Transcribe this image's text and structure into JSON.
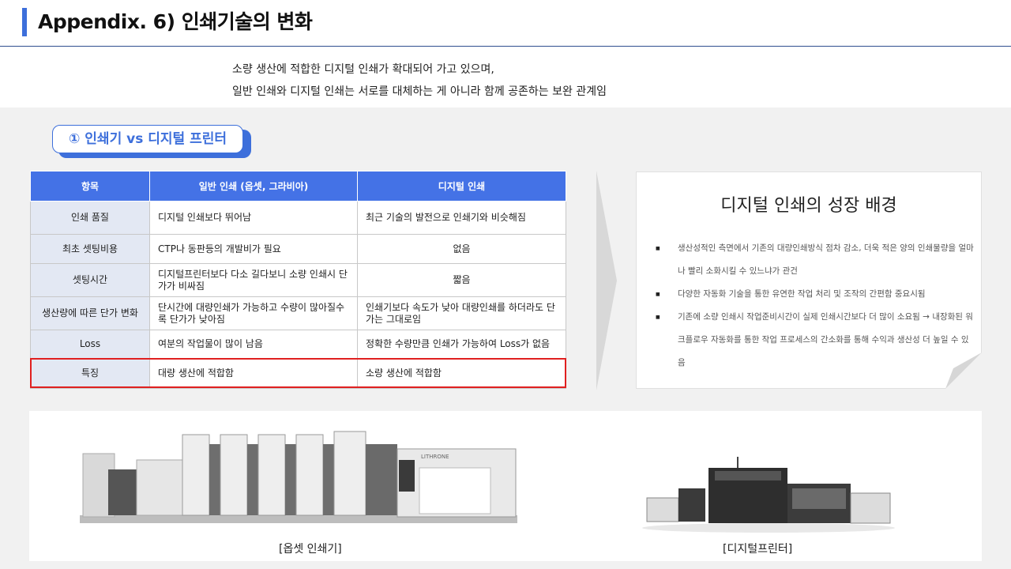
{
  "header": {
    "title": "Appendix. 6) 인쇄기술의 변화"
  },
  "subtitle": {
    "line1": "소량 생산에 적합한 디지털 인쇄가 확대되어 가고 있으며,",
    "line2": "일반 인쇄와 디지털 인쇄는 서로를 대체하는 게 아니라 함께 공존하는 보완 관계임"
  },
  "section": {
    "label": "① 인쇄기 vs 디지털 프린터"
  },
  "table": {
    "headers": [
      "항목",
      "일반 인쇄 (옵셋, 그라비아)",
      "디지털  인쇄"
    ],
    "rows": [
      [
        "인쇄 품질",
        "디지털 인쇄보다 뛰어남",
        "최근 기술의 발전으로 인쇄기와 비슷해짐"
      ],
      [
        "최초 셋팅비용",
        "CTP나 동판등의 개발비가 필요",
        "없음"
      ],
      [
        "셋팅시간",
        "디지털프린터보다 다소 길다보니 소량 인쇄시 단가가 비싸짐",
        "짧음"
      ],
      [
        "생산량에 따른 단가 변화",
        "단시간에 대량인쇄가 가능하고 수량이 많아질수록 단가가 낮아짐",
        "인쇄기보다 속도가 낮아 대량인쇄를 하더라도 단가는 그대로임"
      ],
      [
        "Loss",
        "여분의 작업물이 많이 남음",
        "정확한 수량만큼 인쇄가 가능하여 Loss가 없음"
      ],
      [
        "특징",
        "대량 생산에 적합함",
        "소량 생산에 적합함"
      ]
    ]
  },
  "card": {
    "title": "디지털 인쇄의 성장 배경",
    "bullets": [
      "생산성적인 측면에서 기존의 대량인쇄방식 점차 감소, 더욱 적은 양의 인쇄물량을 얼마나 빨리 소화시킬 수 있느냐가 관건",
      "다양한 자동화 기술을 통한 유연한 작업 처리 및 조작의 간편함 중요시됨",
      "기존에 소량 인쇄시 작업준비시간이 실제 인쇄시간보다 더 많이 소요됨 → 내장화된 워크플로우 자동화를 통한 작업 프로세스의 간소화를 통해 수익과 생산성 더 높일 수 있음"
    ]
  },
  "images": {
    "offset_caption": "[옵셋 인쇄기]",
    "digital_caption": "[디지털프린터]",
    "offset_brand": "LITHRONE"
  },
  "colors": {
    "accent": "#3d6fdb",
    "header_blue": "#4472e6",
    "highlight_red": "#e02020"
  },
  "icons": {
    "arrow": "chevron-right-arrow",
    "fold": "page-curl"
  }
}
